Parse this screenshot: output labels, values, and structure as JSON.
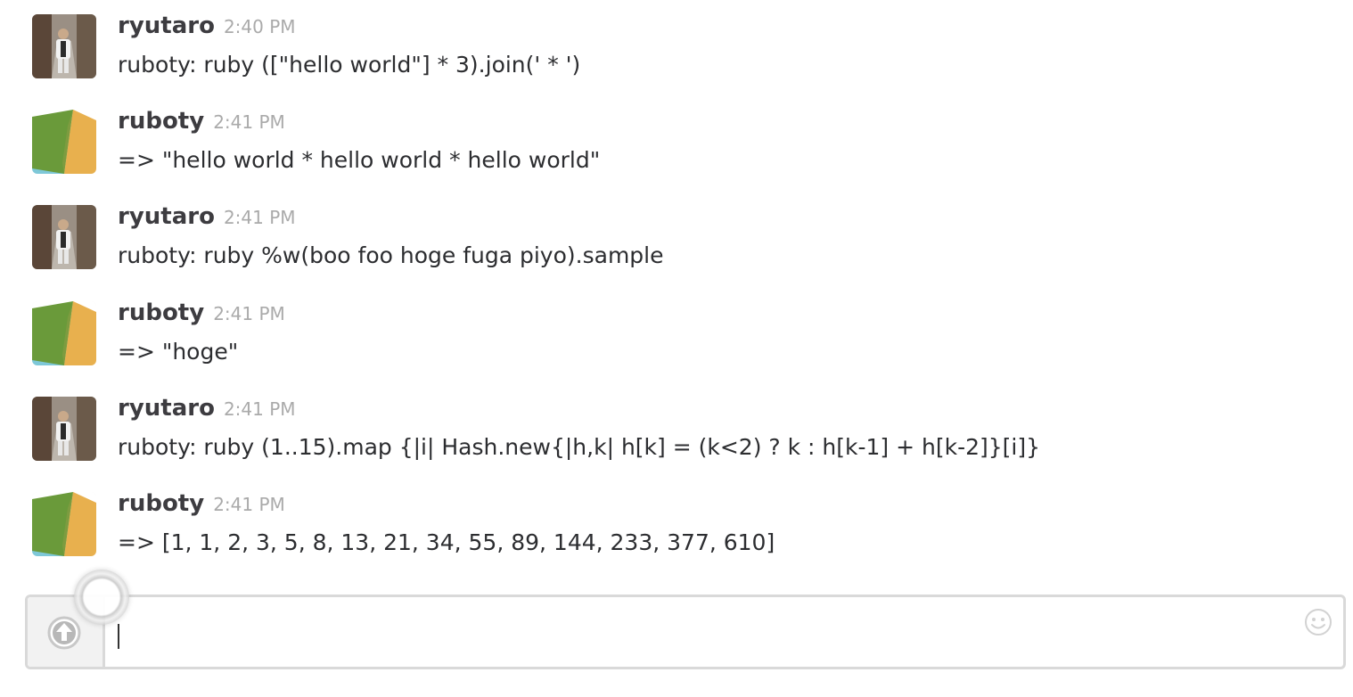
{
  "messages": [
    {
      "author": "ryutaro",
      "time": "2:40 PM",
      "text": "ruboty: ruby ([\"hello world\"] * 3).join(' * ')",
      "avatar": "ryutaro"
    },
    {
      "author": "ruboty",
      "time": "2:41 PM",
      "text": "=> \"hello world * hello world * hello world\"",
      "avatar": "ruboty"
    },
    {
      "author": "ryutaro",
      "time": "2:41 PM",
      "text": "ruboty: ruby %w(boo foo hoge fuga piyo).sample",
      "avatar": "ryutaro"
    },
    {
      "author": "ruboty",
      "time": "2:41 PM",
      "text": "=> \"hoge\"",
      "avatar": "ruboty"
    },
    {
      "author": "ryutaro",
      "time": "2:41 PM",
      "text": "ruboty: ruby (1..15).map {|i| Hash.new{|h,k| h[k] = (k<2) ? k : h[k-1] + h[k-2]}[i]}",
      "avatar": "ryutaro"
    },
    {
      "author": "ruboty",
      "time": "2:41 PM",
      "text": "=> [1, 1, 2, 3, 5, 8, 13, 21, 34, 55, 89, 144, 233, 377, 610]",
      "avatar": "ruboty"
    }
  ],
  "composer": {
    "value": "",
    "upload_icon": "upload-arrow-icon",
    "emoji_icon": "smiley-face-icon"
  },
  "colors": {
    "ruboty_green": "#6a9a3a",
    "ruboty_yellow": "#e8b04e",
    "ruboty_blue": "#7ec8d8",
    "timestamp": "#aaaaaa",
    "author": "#3d3c40"
  }
}
